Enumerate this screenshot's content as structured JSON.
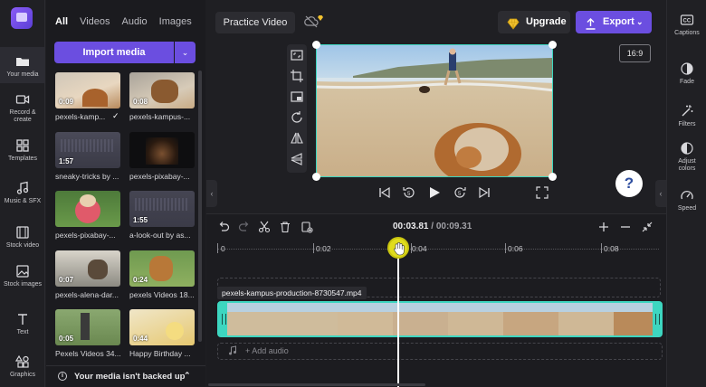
{
  "nav": {
    "items": [
      {
        "label": "Your media",
        "icon": "folder-icon"
      },
      {
        "label": "Record & create",
        "icon": "camera-icon"
      },
      {
        "label": "Templates",
        "icon": "templates-icon"
      },
      {
        "label": "Music & SFX",
        "icon": "music-icon"
      },
      {
        "label": "Stock video",
        "icon": "film-icon"
      },
      {
        "label": "Stock images",
        "icon": "image-icon"
      },
      {
        "label": "Text",
        "icon": "text-icon"
      },
      {
        "label": "Graphics",
        "icon": "shapes-icon"
      }
    ]
  },
  "media": {
    "tabs": [
      "All",
      "Videos",
      "Audio",
      "Images"
    ],
    "import_label": "Import media",
    "items": [
      {
        "name": "pexels-kamp...",
        "duration": "0:09",
        "checked": true
      },
      {
        "name": "pexels-kampus-...",
        "duration": "0:08"
      },
      {
        "name": "sneaky-tricks by ...",
        "duration": "1:57"
      },
      {
        "name": "pexels-pixabay-...",
        "duration": ""
      },
      {
        "name": "pexels-pixabay-...",
        "duration": ""
      },
      {
        "name": "a-look-out by as...",
        "duration": "1:55"
      },
      {
        "name": "pexels-alena-dar...",
        "duration": "0:07"
      },
      {
        "name": "pexels Videos 18...",
        "duration": "0:24"
      },
      {
        "name": "Pexels Videos 34...",
        "duration": "0:05"
      },
      {
        "name": "Happy Birthday ...",
        "duration": "0:44"
      }
    ],
    "backup_text": "Your media isn't backed up"
  },
  "header": {
    "project_title": "Practice Video",
    "upgrade_label": "Upgrade",
    "export_label": "Export",
    "aspect_ratio": "16:9"
  },
  "right_tools": [
    {
      "label": "Captions",
      "icon": "cc-icon"
    },
    {
      "label": "Fade",
      "icon": "fade-icon"
    },
    {
      "label": "Filters",
      "icon": "filters-icon"
    },
    {
      "label": "Adjust colors",
      "icon": "adjust-icon"
    },
    {
      "label": "Speed",
      "icon": "speed-icon"
    }
  ],
  "timeline": {
    "current_time": "00:03.81",
    "separator": "/",
    "total_time": "00:09.31",
    "ruler": [
      "0",
      "0:02",
      "0:04",
      "0:06",
      "0:08"
    ],
    "clip_name": "pexels-kampus-production-8730547.mp4",
    "add_audio": "Add audio"
  },
  "colors": {
    "accent": "#6b4ee0",
    "clip": "#3dd6c0",
    "playhead": "#e0dc1e"
  }
}
